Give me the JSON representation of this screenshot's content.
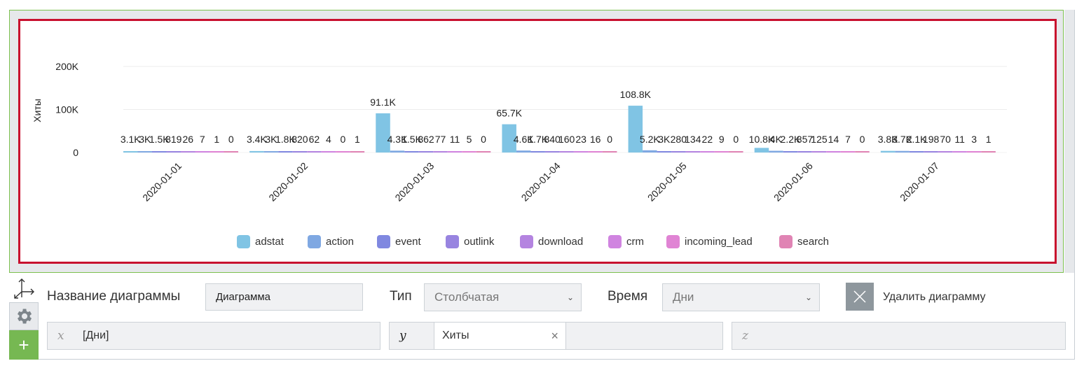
{
  "chart_data": {
    "type": "bar",
    "title": "",
    "xlabel": "",
    "ylabel": "Хиты",
    "ylim": [
      0,
      200000
    ],
    "yticks": [
      0,
      100000,
      200000
    ],
    "ytick_labels": [
      "0",
      "100K",
      "200K"
    ],
    "grid": true,
    "legend_position": "bottom",
    "categories": [
      "2020-01-01",
      "2020-01-02",
      "2020-01-03",
      "2020-01-04",
      "2020-01-05",
      "2020-01-06",
      "2020-01-07"
    ],
    "series": [
      {
        "name": "adstat",
        "color": "#80c4e4",
        "values": [
          3100,
          3400,
          91100,
          65700,
          108800,
          10800,
          3800
        ],
        "labels": [
          "3.1K",
          "3.4K",
          "91.1K",
          "65.7K",
          "108.8K",
          "10.8K",
          "3.8K"
        ]
      },
      {
        "name": "action",
        "color": "#7fa8e2",
        "values": [
          3000,
          3000,
          4300,
          4600,
          5200,
          4000,
          3700
        ],
        "labels": [
          "3K",
          "3K",
          "4.3K",
          "4.6K",
          "5.2K",
          "4K",
          "3.7K"
        ]
      },
      {
        "name": "event",
        "color": "#8088e0",
        "values": [
          1500,
          1800,
          1500,
          1700,
          3000,
          2200,
          2100
        ],
        "labels": [
          "1.5K",
          "1.8K",
          "1.5K",
          "1.7K",
          "3K",
          "2.2K",
          "2.1K"
        ]
      },
      {
        "name": "outlink",
        "color": "#9884e0",
        "values": [
          819,
          820,
          862,
          840,
          280,
          857,
          198
        ],
        "labels": [
          "819",
          "820",
          "862",
          "840",
          "280",
          "857",
          "198"
        ]
      },
      {
        "name": "download",
        "color": "#b484e0",
        "values": [
          26,
          62,
          77,
          160,
          134,
          125,
          70
        ],
        "labels": [
          "26",
          "62",
          "77",
          "160",
          "134",
          "125",
          "70"
        ]
      },
      {
        "name": "crm",
        "color": "#d084e0",
        "values": [
          7,
          4,
          11,
          23,
          22,
          14,
          11
        ],
        "labels": [
          "7",
          "4",
          "11",
          "23",
          "22",
          "14",
          "11"
        ]
      },
      {
        "name": "incoming_lead",
        "color": "#e084d4",
        "values": [
          1,
          0,
          5,
          16,
          9,
          7,
          3
        ],
        "labels": [
          "1",
          "0",
          "5",
          "16",
          "9",
          "7",
          "3"
        ]
      },
      {
        "name": "search",
        "color": "#e084b4",
        "values": [
          0,
          1,
          0,
          0,
          0,
          0,
          1
        ],
        "labels": [
          "0",
          "1",
          "0",
          "0",
          "0",
          "0",
          "1"
        ]
      }
    ]
  },
  "form": {
    "name_label": "Название диаграммы",
    "name_value": "Диаграмма",
    "type_label": "Тип",
    "type_value": "Столбчатая",
    "time_label": "Время",
    "time_value": "Дни",
    "delete_label": "Удалить диаграмму",
    "x_letter": "x",
    "x_value": "[Дни]",
    "y_letter": "y",
    "y_value": "Хиты",
    "y_clear": "×",
    "z_letter": "z"
  },
  "sidebar": {
    "plus": "+"
  }
}
